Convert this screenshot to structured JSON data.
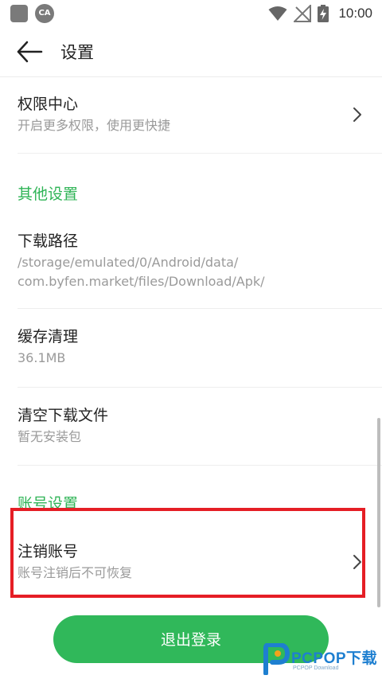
{
  "status_bar": {
    "app_icon_text": "CA",
    "time": "10:00"
  },
  "header": {
    "title": "设置"
  },
  "items": {
    "permission": {
      "title": "权限中心",
      "subtitle": "开启更多权限，使用更快捷"
    },
    "download_path": {
      "title": "下载路径",
      "subtitle_line1": "/storage/emulated/0/Android/data/",
      "subtitle_line2": "com.byfen.market/files/Download/Apk/"
    },
    "cache": {
      "title": "缓存清理",
      "subtitle": "36.1MB"
    },
    "clear_downloads": {
      "title": "清空下载文件",
      "subtitle": "暂无安装包"
    },
    "cancel_account": {
      "title": "注销账号",
      "subtitle": "账号注销后不可恢复"
    }
  },
  "sections": {
    "other": "其他设置",
    "account": "账号设置"
  },
  "logout": {
    "label": "退出登录"
  },
  "watermark": {
    "brand": "PCPOP下载",
    "small": "PCPOP Download"
  },
  "colors": {
    "accent_green": "#30b85a",
    "section_green": "#2fb456",
    "highlight_red": "#e51e25",
    "watermark_blue": "#1e7fd0"
  }
}
